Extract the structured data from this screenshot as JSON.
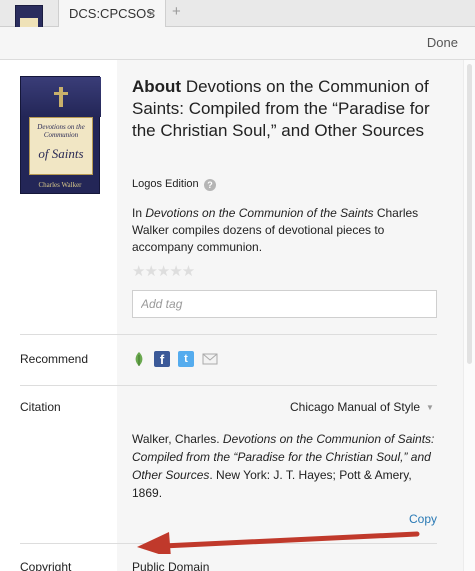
{
  "tab": {
    "label": "DCS:CPCSOS",
    "close": "×",
    "add": "+"
  },
  "header": {
    "done_label": "Done"
  },
  "book": {
    "cover_title_line1": "Devotions on the",
    "cover_title_line2": "Communion",
    "cover_title_big": "of Saints",
    "cover_author": "Charles Walker"
  },
  "about": {
    "prefix": "About",
    "title": "Devotions on the Communion of Saints: Compiled from the “Paradise for the Christian Soul,” and Other Sources",
    "edition": "Logos Edition",
    "help_glyph": "?",
    "desc_pre": "In ",
    "desc_italic": "Devotions on the Communion of the Saints",
    "desc_post": " Charles Walker compiles dozens of devotional pieces to accompany communion.",
    "stars": "★★★★★",
    "tag_placeholder": "Add tag"
  },
  "recommend": {
    "label": "Recommend",
    "icons": [
      "leaf-icon",
      "facebook-icon",
      "twitter-icon",
      "email-icon"
    ],
    "fb_glyph": "f",
    "tw_glyph": "t"
  },
  "citation": {
    "label": "Citation",
    "style": "Chicago Manual of Style",
    "author": "Walker, Charles. ",
    "title_italic": "Devotions on the Communion of Saints: Compiled from the “Paradise for the Christian Soul,” and Other Sources",
    "rest": ". New York: J. T. Hayes; Pott & Amery, 1869.",
    "copy_label": "Copy"
  },
  "copyright": {
    "label": "Copyright",
    "value": "Public Domain"
  },
  "colors": {
    "arrow": "#c0392b",
    "link": "#2a7ab5",
    "facebook": "#3b5998",
    "twitter": "#55acee"
  }
}
